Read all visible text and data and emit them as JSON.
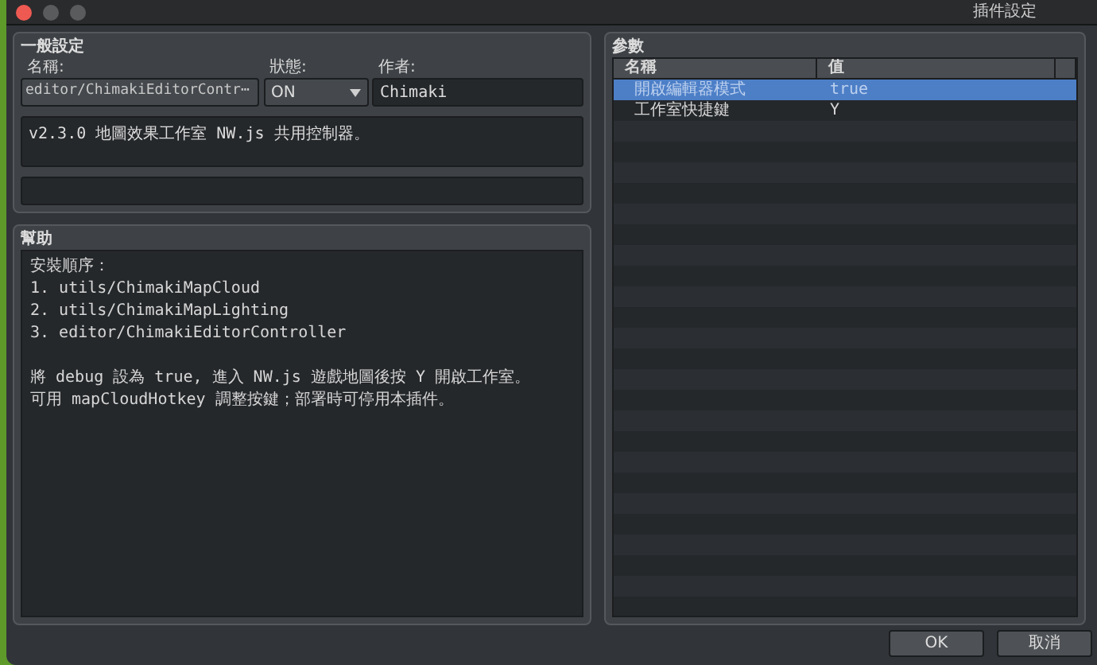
{
  "window": {
    "title": "插件設定"
  },
  "general": {
    "title": "一般設定",
    "name": {
      "label": "名稱:",
      "value": "editor/ChimakiEditorContr⋯"
    },
    "status": {
      "label": "狀態:",
      "value": "ON"
    },
    "author": {
      "label": "作者:",
      "value": "Chimaki"
    },
    "description": "v2.3.0 地圖效果工作室 NW.js 共用控制器。"
  },
  "help": {
    "title": "幫助",
    "paragraphs": [
      [
        "安裝順序：",
        "1. utils/ChimakiMapCloud",
        "2. utils/ChimakiMapLighting",
        "3. editor/ChimakiEditorController"
      ],
      [
        "將 debug 設為 true, 進入 NW.js 遊戲地圖後按 Y 開啟工作室。",
        "可用 mapCloudHotkey 調整按鍵；部署時可停用本插件。"
      ]
    ]
  },
  "parameters": {
    "title": "參數",
    "columns": [
      "名稱",
      "值"
    ],
    "rows": [
      {
        "name": "開啟編輯器模式",
        "value": "true",
        "selected": true
      },
      {
        "name": "工作室快捷鍵",
        "value": "Y",
        "selected": false
      }
    ]
  },
  "buttons": [
    "OK",
    "取消"
  ]
}
